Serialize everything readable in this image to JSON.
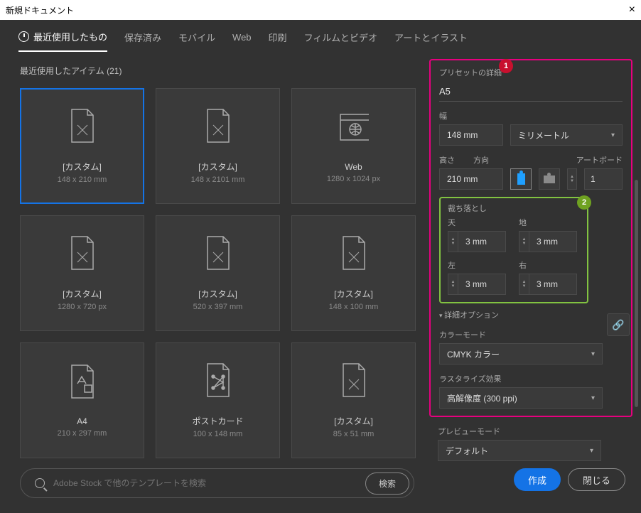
{
  "title": "新規ドキュメント",
  "tabs": [
    "最近使用したもの",
    "保存済み",
    "モバイル",
    "Web",
    "印刷",
    "フィルムとビデオ",
    "アートとイラスト"
  ],
  "subtitle": "最近使用したアイテム (21)",
  "cards": [
    {
      "label": "[カスタム]",
      "dim": "148 x 210 mm",
      "icon": "page"
    },
    {
      "label": "[カスタム]",
      "dim": "148 x 2101 mm",
      "icon": "page"
    },
    {
      "label": "Web",
      "dim": "1280 x 1024 px",
      "icon": "globe"
    },
    {
      "label": "[カスタム]",
      "dim": "1280 x 720 px",
      "icon": "page"
    },
    {
      "label": "[カスタム]",
      "dim": "520 x 397 mm",
      "icon": "page"
    },
    {
      "label": "[カスタム]",
      "dim": "148 x 100 mm",
      "icon": "page"
    },
    {
      "label": "A4",
      "dim": "210 x 297 mm",
      "icon": "a4"
    },
    {
      "label": "ポストカード",
      "dim": "100 x 148 mm",
      "icon": "postcard"
    },
    {
      "label": "[カスタム]",
      "dim": "85 x 51 mm",
      "icon": "page"
    }
  ],
  "search": {
    "placeholder": "Adobe Stock で他のテンプレートを検索",
    "button": "検索"
  },
  "preset": {
    "title": "プリセットの詳細",
    "name": "A5",
    "width_label": "幅",
    "width": "148 mm",
    "unit": "ミリメートル",
    "height_label": "高さ",
    "height": "210 mm",
    "orient_label": "方向",
    "artboard_label": "アートボード",
    "artboards": "1",
    "bleed_title": "裁ち落とし",
    "bleed": {
      "top_l": "天",
      "bottom_l": "地",
      "left_l": "左",
      "right_l": "右",
      "val": "3 mm"
    },
    "advanced": "詳細オプション",
    "colormode_label": "カラーモード",
    "colormode": "CMYK カラー",
    "raster_label": "ラスタライズ効果",
    "raster": "高解像度 (300 ppi)",
    "preview_label": "プレビューモード",
    "preview": "デフォルト"
  },
  "annotations": {
    "one": "1",
    "two": "2"
  },
  "footer": {
    "create": "作成",
    "close": "閉じる"
  }
}
